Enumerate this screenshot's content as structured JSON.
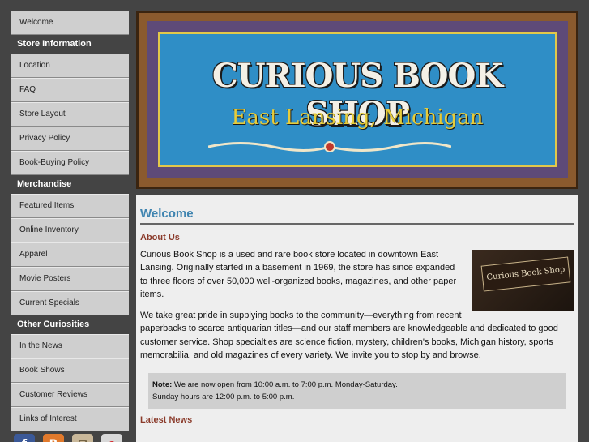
{
  "sidebar": {
    "welcome": "Welcome",
    "store_info_heading": "Store Information",
    "store_info_items": [
      "Location",
      "FAQ",
      "Store Layout",
      "Privacy Policy",
      "Book-Buying Policy"
    ],
    "merch_heading": "Merchandise",
    "merch_items": [
      "Featured Items",
      "Online Inventory",
      "Apparel",
      "Movie Posters",
      "Current Specials"
    ],
    "other_heading": "Other Curiosities",
    "other_items": [
      "In the News",
      "Book Shows",
      "Customer Reviews",
      "Links of Interest"
    ],
    "social": [
      {
        "icon": "facebook-icon",
        "glyph": "f",
        "color": "#3b5998"
      },
      {
        "icon": "blogger-icon",
        "glyph": "B",
        "color": "#e27a2c"
      },
      {
        "icon": "mail-icon",
        "glyph": "✉",
        "color": "#c9b89a"
      },
      {
        "icon": "ebay-icon",
        "glyph": "e",
        "color": "#d8d8d8"
      }
    ]
  },
  "banner": {
    "title": "CURIOUS BOOK SHOP",
    "subtitle": "East Lansing, Michigan"
  },
  "main": {
    "title": "Welcome",
    "about_heading": "About Us",
    "para1": "Curious Book Shop is a used and rare book store located in downtown East Lansing. Originally started in a basement in 1969, the store has since expanded to three floors of over 50,000 well-organized books, magazines, and other paper items.",
    "para2": "We take great pride in supplying books to the community—everything from recent paperbacks to scarce antiquarian titles—and our staff members are knowledgeable and dedicated to good customer service. Shop specialties are science fiction, mystery, children's books, Michigan history, sports memorabilia, and old magazines of every variety. We invite you to stop by and browse.",
    "photo_sign": "Curious Book Shop",
    "note_label": "Note:",
    "note_line1": " We are now open from 10:00 a.m. to 7:00 p.m. Monday-Saturday.",
    "note_line2": "Sunday hours are 12:00 p.m. to 5:00 p.m.",
    "latest_heading": "Latest News"
  }
}
